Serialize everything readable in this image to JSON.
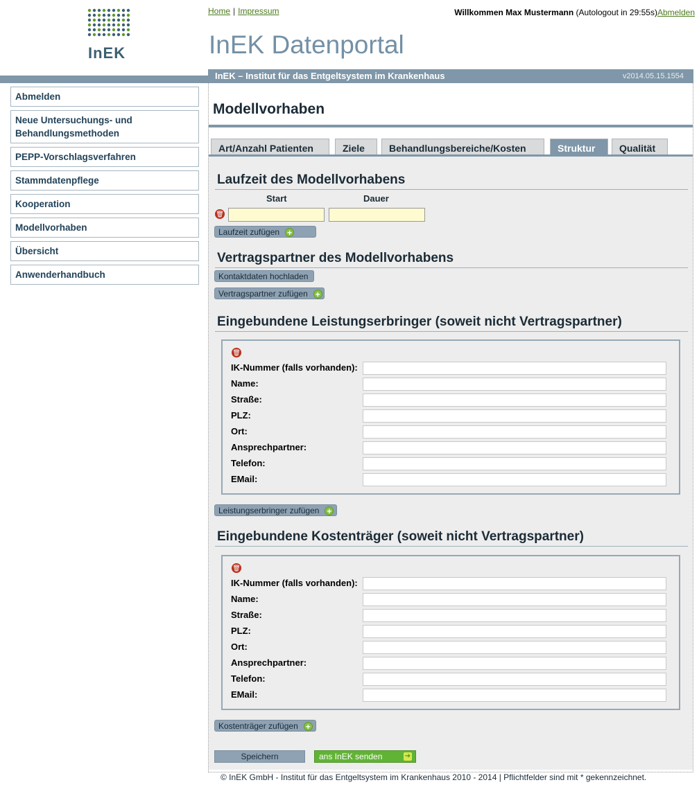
{
  "nav": {
    "home": "Home",
    "sep": "|",
    "impressum": "Impressum"
  },
  "user": {
    "welcome": "Willkommen Max Mustermann",
    "autologout": "(Autologout in   29:55s)",
    "logout": "Abmelden"
  },
  "app": {
    "title": "InEK Datenportal",
    "logo_text": "InEK",
    "subtitle": "InEK – Institut für das Entgeltsystem im Krankenhaus",
    "version": "v2014.05.15.1554"
  },
  "sidebar": {
    "items": [
      {
        "label": "Abmelden"
      },
      {
        "label": "Neue Untersuchungs- und Behandlungsmethoden"
      },
      {
        "label": "PEPP-Vorschlagsverfahren"
      },
      {
        "label": "Stammdatenpflege"
      },
      {
        "label": "Kooperation"
      },
      {
        "label": "Modellvorhaben"
      },
      {
        "label": "Übersicht"
      },
      {
        "label": "Anwenderhandbuch"
      }
    ]
  },
  "page": {
    "title": "Modellvorhaben"
  },
  "tabs": [
    {
      "label": "Art/Anzahl Patienten",
      "active": false
    },
    {
      "label": "Ziele",
      "active": false
    },
    {
      "label": "Behandlungsbereiche/Kosten",
      "active": false
    },
    {
      "label": "Struktur",
      "active": true
    },
    {
      "label": "Qualität",
      "active": false
    }
  ],
  "laufzeit": {
    "heading": "Laufzeit des Modellvorhabens",
    "col_start": "Start",
    "col_dauer": "Dauer",
    "start_value": "",
    "dauer_value": "",
    "add_button": "Laufzeit zufügen"
  },
  "vertragspartner": {
    "heading": "Vertragspartner des Modellvorhabens",
    "upload_button": "Kontaktdaten hochladen",
    "add_button": "Vertragspartner zufügen"
  },
  "leistungserbringer": {
    "heading": "Eingebundene Leistungserbringer (soweit nicht Vertragspartner)",
    "add_button": "Leistungserbringer zufügen"
  },
  "kostentraeger": {
    "heading": "Eingebundene Kostenträger (soweit nicht Vertragspartner)",
    "add_button": "Kostenträger zufügen"
  },
  "fields": [
    {
      "label": "IK-Nummer (falls vorhanden):",
      "value": ""
    },
    {
      "label": "Name:",
      "value": ""
    },
    {
      "label": "Straße:",
      "value": ""
    },
    {
      "label": "PLZ:",
      "value": ""
    },
    {
      "label": "Ort:",
      "value": ""
    },
    {
      "label": "Ansprechpartner:",
      "value": ""
    },
    {
      "label": "Telefon:",
      "value": ""
    },
    {
      "label": "EMail:",
      "value": ""
    }
  ],
  "actions": {
    "save": "Speichern",
    "send": "ans InEK senden"
  },
  "footer": {
    "text": "© InEK GmbH - Institut für das Entgeltsystem im Krankenhaus 2010 - 2014 | Pflichtfelder sind mit * gekennzeichnet."
  },
  "colors": {
    "accent": "#7f97a8",
    "link": "#4a7a1c",
    "input_yellow": "#fffbd0",
    "send_green": "#61b335"
  },
  "icons": {
    "delete": "trash-icon",
    "add": "plus-circle-icon",
    "send": "arrow-right-icon"
  }
}
